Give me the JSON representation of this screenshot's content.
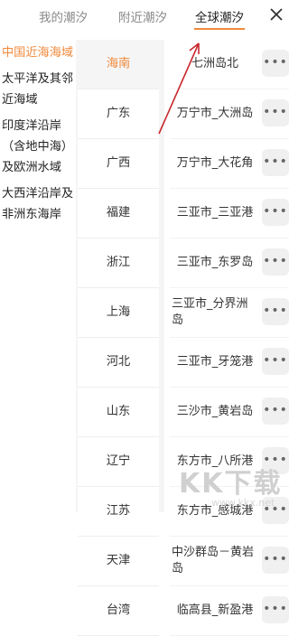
{
  "tabs": [
    {
      "label": "我的潮汐"
    },
    {
      "label": "附近潮汐"
    },
    {
      "label": "全球潮汐"
    }
  ],
  "close_icon": "close-icon",
  "regions": [
    {
      "label": "中国近海海域",
      "active": true
    },
    {
      "label": "太平洋及其邻近海域"
    },
    {
      "label": "印度洋沿岸（含地中海）及欧洲水域"
    },
    {
      "label": "大西洋沿岸及非洲东海岸"
    }
  ],
  "provinces": [
    {
      "label": "海南",
      "active": true
    },
    {
      "label": "广东"
    },
    {
      "label": "广西"
    },
    {
      "label": "福建"
    },
    {
      "label": "浙江"
    },
    {
      "label": "上海"
    },
    {
      "label": "河北"
    },
    {
      "label": "山东"
    },
    {
      "label": "辽宁"
    },
    {
      "label": "江苏"
    },
    {
      "label": "天津"
    },
    {
      "label": "台湾"
    }
  ],
  "stations": [
    {
      "label": "七洲岛北"
    },
    {
      "label": "万宁市_大洲岛"
    },
    {
      "label": "万宁市_大花角"
    },
    {
      "label": "三亚市_三亚港"
    },
    {
      "label": "三亚市_东罗岛"
    },
    {
      "label": "三亚市_分界洲岛"
    },
    {
      "label": "三亚市_牙笼港"
    },
    {
      "label": "三沙市_黄岩岛"
    },
    {
      "label": "东方市_八所港"
    },
    {
      "label": "东方市_感城港"
    },
    {
      "label": "中沙群岛－黄岩岛"
    },
    {
      "label": "临高县_新盈港"
    }
  ],
  "more_label": "•••",
  "colors": {
    "accent": "#f08a3c",
    "annotation_arrow": "#c8282e"
  },
  "watermark": {
    "logo": "KK下载",
    "url": "www.kkx.net"
  }
}
